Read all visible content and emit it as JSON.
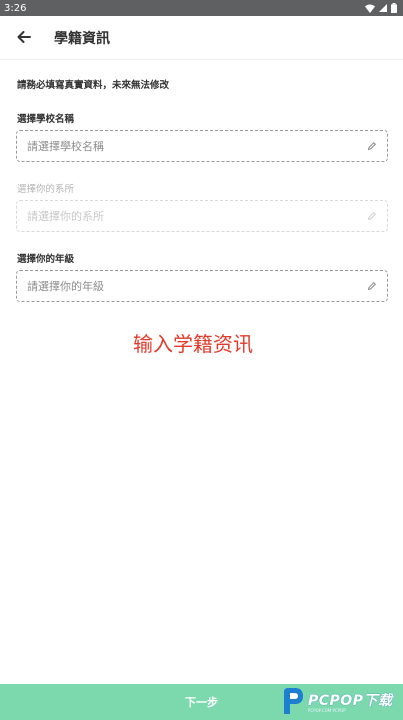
{
  "status_bar": {
    "time": "3:26"
  },
  "app_bar": {
    "title": "學籍資訊"
  },
  "notice": "請務必填寫真實資料，未來無法修改",
  "fields": [
    {
      "label": "選擇學校名稱",
      "placeholder": "請選擇學校名稱",
      "enabled": true
    },
    {
      "label": "選擇你的系所",
      "placeholder": "請選擇你的系所",
      "enabled": false
    },
    {
      "label": "選擇你的年級",
      "placeholder": "請選擇你的年級",
      "enabled": true
    }
  ],
  "overlay_caption": "输入学籍资讯",
  "bottom_bar": {
    "next_label": "下一步"
  },
  "watermark": {
    "text": "PCPOP下载",
    "sub": "PCPOP.COM PCPOP"
  },
  "colors": {
    "accent_green": "#7cd8ad",
    "caption_red": "#e23b2b",
    "status_bar": "#5f6062"
  },
  "icons": [
    "back-arrow-icon",
    "wifi-icon",
    "signal-icon",
    "battery-icon",
    "edit-pencil-icon"
  ]
}
